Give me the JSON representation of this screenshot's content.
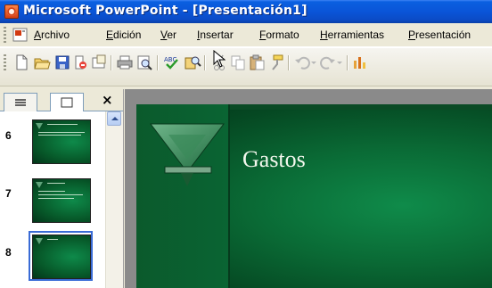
{
  "window": {
    "title": "Microsoft PowerPoint - [Presentación1]"
  },
  "menu": {
    "items": [
      {
        "key": "A",
        "rest": "rchivo"
      },
      {
        "key": "E",
        "rest": "dición"
      },
      {
        "key": "V",
        "rest": "er"
      },
      {
        "key": "I",
        "rest": "nsertar"
      },
      {
        "key": "F",
        "rest": "ormato"
      },
      {
        "key": "H",
        "rest": "erramientas"
      },
      {
        "key": "P",
        "rest": "resentación"
      }
    ]
  },
  "toolbar": {
    "buttons": [
      "new-icon",
      "open-icon",
      "save-icon",
      "permission-icon",
      "email-icon",
      "print-icon",
      "print-preview-icon",
      "spelling-icon",
      "research-icon",
      "cut-icon",
      "copy-icon",
      "paste-icon",
      "format-painter-icon",
      "undo-icon",
      "redo-icon",
      "insert-chart-icon"
    ]
  },
  "pane": {
    "close_glyph": "×",
    "slides": [
      {
        "number": "6"
      },
      {
        "number": "7"
      },
      {
        "number": "8",
        "selected": true
      }
    ]
  },
  "slide": {
    "title": "Gastos"
  },
  "colors": {
    "titlebar": "#0a55d8",
    "slide_green": "#0a6a35",
    "selection": "#3a6bd6"
  }
}
